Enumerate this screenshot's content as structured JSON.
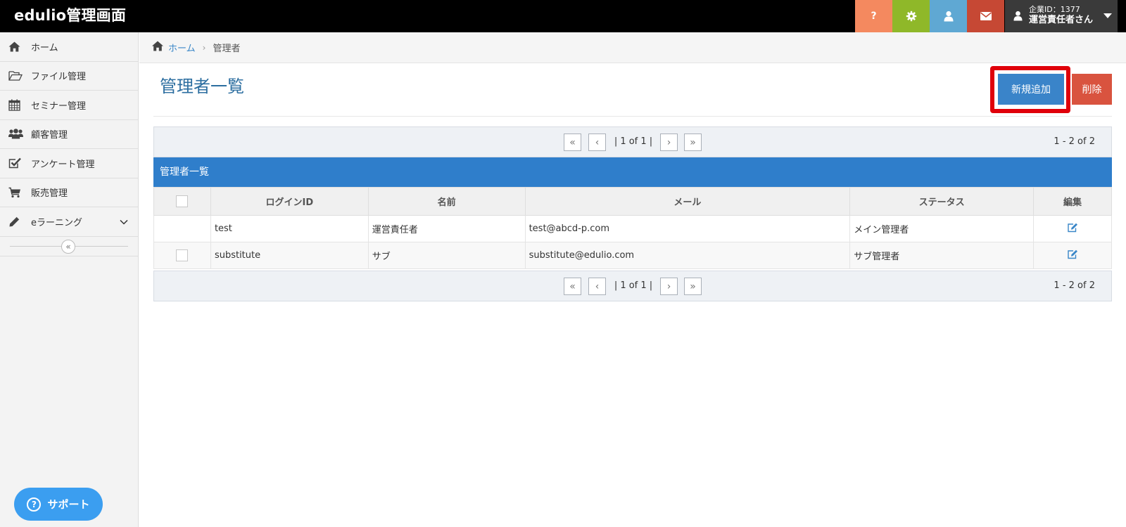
{
  "header": {
    "brand": "edulio管理画面",
    "account_line1": "企業ID：1377",
    "account_line2": "運営責任者さん",
    "icons": [
      "help-icon",
      "gear-icon",
      "user-icon",
      "mail-icon"
    ],
    "colors": {
      "help": "#f4895f",
      "gear": "#8fb829",
      "user": "#5fa8d3",
      "mail": "#c64834",
      "account": "#3a3a3a"
    }
  },
  "sidebar": {
    "items": [
      {
        "label": "ホーム",
        "icon": "home-icon"
      },
      {
        "label": "ファイル管理",
        "icon": "folder-open-icon"
      },
      {
        "label": "セミナー管理",
        "icon": "calendar-icon"
      },
      {
        "label": "顧客管理",
        "icon": "users-icon"
      },
      {
        "label": "アンケート管理",
        "icon": "checkbox-icon"
      },
      {
        "label": "販売管理",
        "icon": "cart-icon"
      },
      {
        "label": "eラーニング",
        "icon": "pencil-icon"
      }
    ],
    "support_label": "サポート"
  },
  "breadcrumb": {
    "home": "ホーム",
    "current": "管理者"
  },
  "page": {
    "title": "管理者一覧",
    "new_button": "新規追加",
    "delete_button": "削除",
    "accent": "#2f7ecb"
  },
  "pager": {
    "page_text": "1 of 1",
    "count_text": "1 - 2 of 2"
  },
  "table": {
    "caption": "管理者一覧",
    "columns": [
      "ログインID",
      "名前",
      "メール",
      "ステータス",
      "編集"
    ],
    "rows": [
      {
        "login_id": "test",
        "name": "運営責任者",
        "email": "test@abcd-p.com",
        "status": "メイン管理者",
        "checkbox": false
      },
      {
        "login_id": "substitute",
        "name": "サブ",
        "email": "substitute@edulio.com",
        "status": "サブ管理者",
        "checkbox": true
      }
    ]
  }
}
